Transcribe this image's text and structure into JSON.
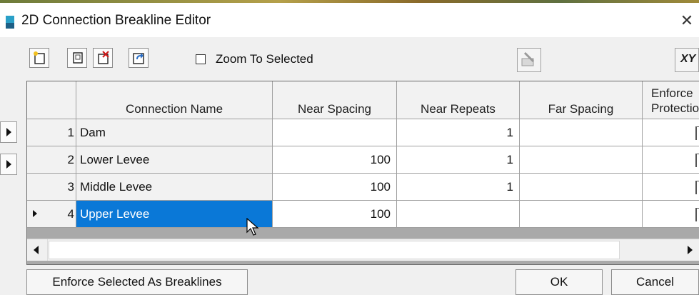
{
  "window": {
    "title": "2D Connection Breakline Editor",
    "close_glyph": "✕"
  },
  "toolbar": {
    "buttons": [
      {
        "icon": "add-row-icon"
      },
      {
        "icon": "copy-row-icon"
      },
      {
        "icon": "delete-row-icon"
      },
      {
        "icon": "undo-icon"
      }
    ],
    "zoom_to_selected": {
      "label": "Zoom To Selected",
      "checked": false
    },
    "right_buttons": [
      {
        "icon": "breakline-tool-icon"
      },
      {
        "icon": "xy-icon",
        "label": "XY"
      }
    ]
  },
  "table": {
    "columns": [
      "Connection Name",
      "Near Spacing",
      "Near Repeats",
      "Far Spacing",
      "Enforce Protection"
    ],
    "rows": [
      {
        "index": "1",
        "name": "Dam",
        "near_spacing": "",
        "near_repeats": "1",
        "far_spacing": ""
      },
      {
        "index": "2",
        "name": "Lower Levee",
        "near_spacing": "100",
        "near_repeats": "1",
        "far_spacing": ""
      },
      {
        "index": "3",
        "name": "Middle Levee",
        "near_spacing": "100",
        "near_repeats": "1",
        "far_spacing": ""
      },
      {
        "index": "4",
        "name": "Upper Levee",
        "near_spacing": "100",
        "near_repeats": "",
        "far_spacing": "",
        "selected": true,
        "current": true
      }
    ]
  },
  "footer": {
    "enforce_button": "Enforce Selected As Breaklines",
    "ok_button": "OK",
    "cancel_button": "Cancel"
  },
  "colors": {
    "selection": "#0a78d7",
    "grid_background": "#a9a9a9"
  }
}
